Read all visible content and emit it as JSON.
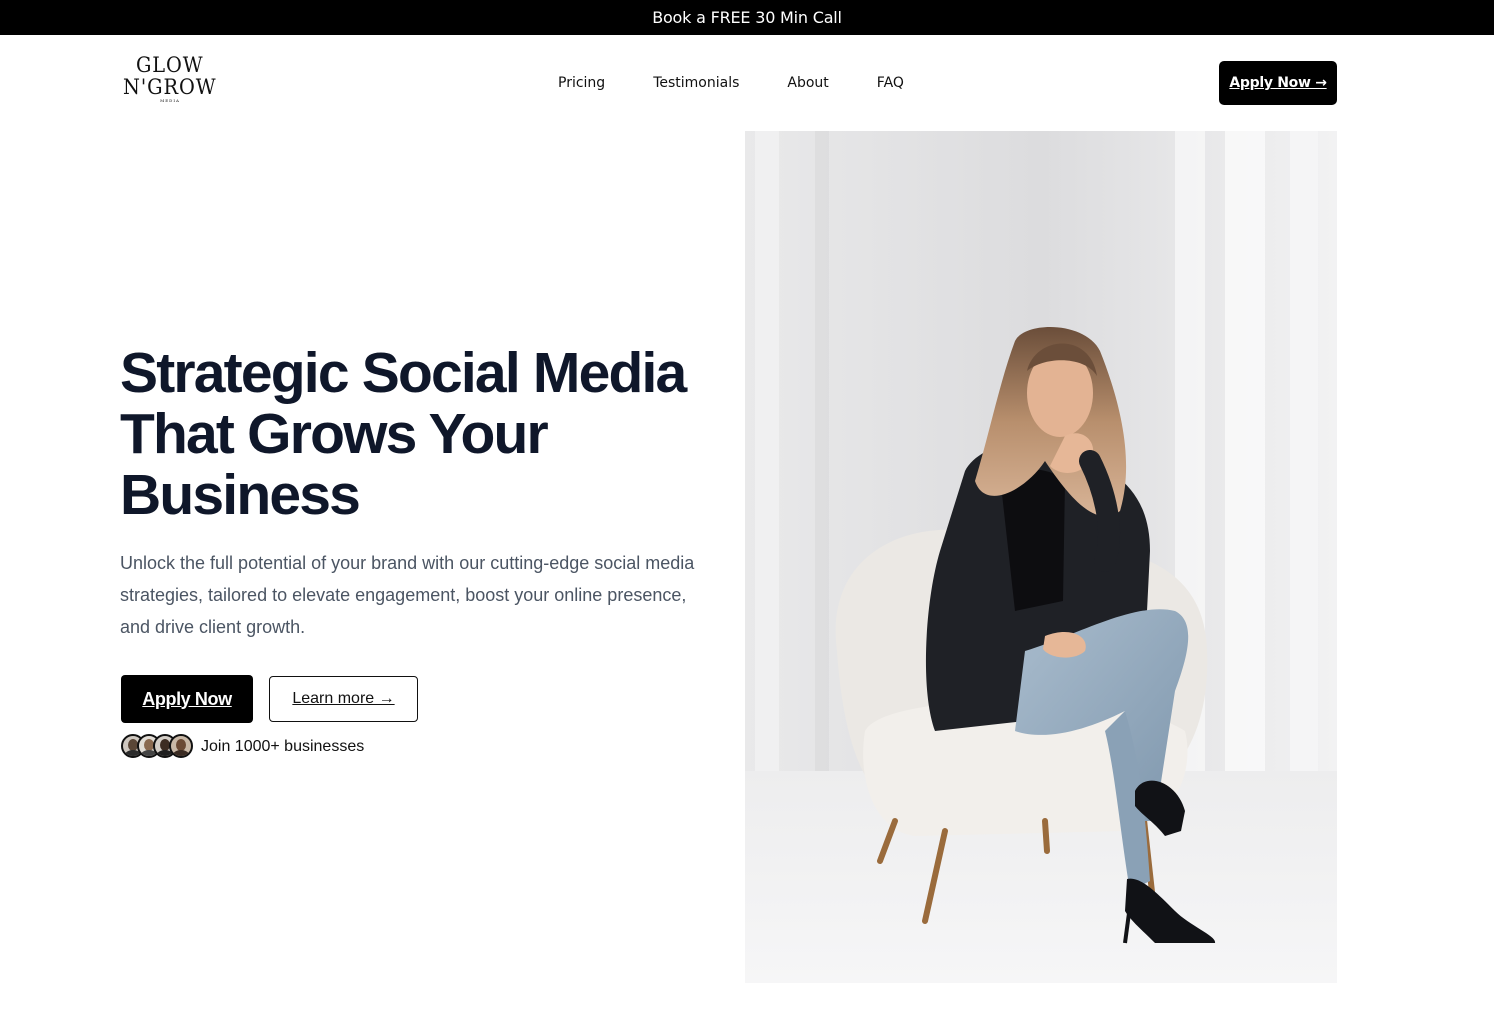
{
  "announcement": {
    "text": "Book a FREE 30 Min Call"
  },
  "brand": {
    "logo_line1": "GLOW",
    "logo_line2": "N'GROW",
    "logo_line3": "MEDIA"
  },
  "nav": {
    "items": [
      {
        "label": "Pricing"
      },
      {
        "label": "Testimonials"
      },
      {
        "label": "About"
      },
      {
        "label": "FAQ"
      }
    ],
    "cta_label": "Apply Now →"
  },
  "hero": {
    "title": "Strategic Social Media That Grows Your Business",
    "description": "Unlock the full potential of your brand with our cutting-edge social media strategies, tailored to elevate engagement, boost your online presence, and drive client growth.",
    "primary_button": "Apply Now",
    "secondary_button": "Learn more →",
    "social_proof": "Join 1000+ businesses"
  },
  "colors": {
    "primary": "#000000",
    "heading": "#0f172a",
    "body_text": "#4b5563"
  },
  "icons": {
    "avatar_group": "customer-avatars",
    "hero_image": "woman-seated-in-white-armchair"
  }
}
